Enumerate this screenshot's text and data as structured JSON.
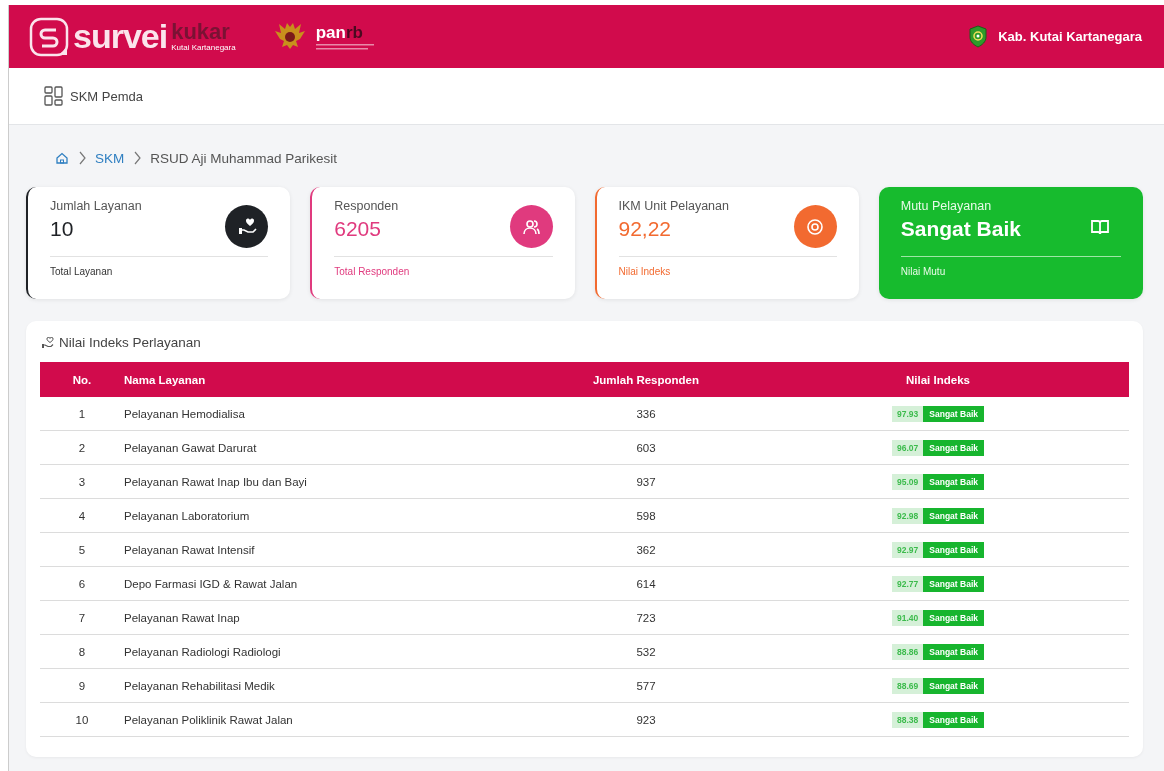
{
  "header": {
    "logo": {
      "word": "survei",
      "accent": "kukar",
      "subtitle": "Kutai Kartanegara"
    },
    "partner_logo": {
      "word": "pan",
      "accent": "rb"
    },
    "region": "Kab. Kutai Kartanegara"
  },
  "subnav": {
    "label": "SKM Pemda"
  },
  "breadcrumb": [
    {
      "label": "SKM",
      "link": true
    },
    {
      "label": "RSUD Aji Muhammad Parikesit",
      "link": false
    }
  ],
  "cards": [
    {
      "kind": "outline",
      "color": "#1f2226",
      "title": "Jumlah Layanan",
      "value": "10",
      "footer": "Total Layanan"
    },
    {
      "kind": "outline",
      "color": "#e03a7e",
      "title": "Responden",
      "value": "6205",
      "footer": "Total Responden"
    },
    {
      "kind": "outline",
      "color": "#f26a30",
      "title": "IKM Unit Pelayanan",
      "value": "92,22",
      "footer": "Nilai Indeks"
    },
    {
      "kind": "filled",
      "color": "#17bb2e",
      "title": "Mutu Pelayanan",
      "value": "Sangat Baik",
      "footer": "Nilai Mutu"
    }
  ],
  "table": {
    "title": "Nilai Indeks Perlayanan",
    "columns": [
      "No.",
      "Nama Layanan",
      "Jumlah Responden",
      "Nilai Indeks"
    ],
    "rows": [
      {
        "no": "1",
        "name": "Pelayanan Hemodialisa",
        "respondents": "336",
        "score": "97.93",
        "grade": "Sangat Baik"
      },
      {
        "no": "2",
        "name": "Pelayanan Gawat Darurat",
        "respondents": "603",
        "score": "96.07",
        "grade": "Sangat Baik"
      },
      {
        "no": "3",
        "name": "Pelayanan Rawat Inap Ibu dan Bayi",
        "respondents": "937",
        "score": "95.09",
        "grade": "Sangat Baik"
      },
      {
        "no": "4",
        "name": "Pelayanan Laboratorium",
        "respondents": "598",
        "score": "92.98",
        "grade": "Sangat Baik"
      },
      {
        "no": "5",
        "name": "Pelayanan Rawat Intensif",
        "respondents": "362",
        "score": "92.97",
        "grade": "Sangat Baik"
      },
      {
        "no": "6",
        "name": "Depo Farmasi IGD & Rawat Jalan",
        "respondents": "614",
        "score": "92.77",
        "grade": "Sangat Baik"
      },
      {
        "no": "7",
        "name": "Pelayanan Rawat Inap",
        "respondents": "723",
        "score": "91.40",
        "grade": "Sangat Baik"
      },
      {
        "no": "8",
        "name": "Pelayanan Radiologi Radiologi",
        "respondents": "532",
        "score": "88.86",
        "grade": "Sangat Baik"
      },
      {
        "no": "9",
        "name": "Pelayanan Rehabilitasi Medik",
        "respondents": "577",
        "score": "88.69",
        "grade": "Sangat Baik"
      },
      {
        "no": "10",
        "name": "Pelayanan Poliklinik Rawat Jalan",
        "respondents": "923",
        "score": "88.38",
        "grade": "Sangat Baik"
      }
    ]
  }
}
